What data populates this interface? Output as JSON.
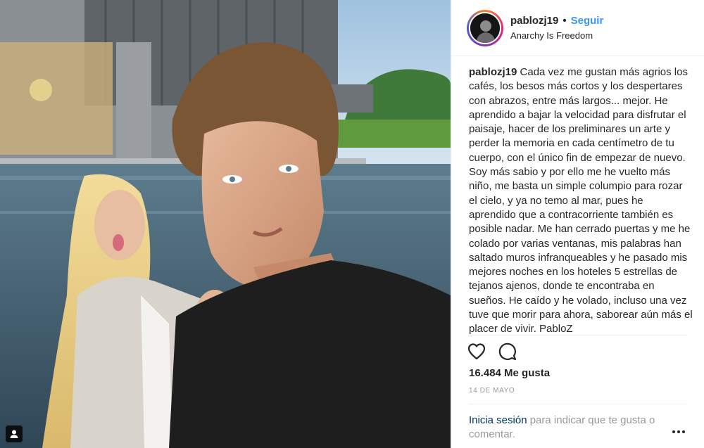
{
  "post": {
    "username": "pablozj19",
    "separator": "•",
    "follow_label": "Seguir",
    "location": "Anarchy Is Freedom",
    "caption_user": "pablozj19",
    "caption_text": "Cada vez me gustan más agrios los cafés, los besos más cortos y los despertares con abrazos, entre más largos... mejor. He aprendido a bajar la velocidad para disfrutar el paisaje, hacer de los preliminares un arte y perder la memoria en cada centímetro de tu cuerpo, con el único fin de empezar de nuevo. Soy más sabio y por ello me he vuelto más niño, me basta un simple columpio para rozar el cielo, y ya no temo al mar, pues he aprendido que a contracorriente también es posible nadar. Me han cerrado puertas y me he colado por varias ventanas, mis palabras han saltado muros infranqueables y he pasado mis mejores noches en los hoteles 5 estrellas de tejanos ajenos, donde te encontraba en sueños. He caído y he volado, incluso una vez tuve que morir para ahora, saborear aún más el placer de vivir. PabloZ",
    "likes": "16.484 Me gusta",
    "date": "14 DE MAYO",
    "login_link": "Inicia sesión",
    "login_rest": " para indicar que te gusta o comentar."
  },
  "icons": {
    "like": "heart-icon",
    "comment": "comment-icon",
    "more": "more-options-icon",
    "tagged": "tagged-user-icon"
  },
  "colors": {
    "follow": "#3897f0",
    "link": "#003569",
    "muted": "#999999",
    "text": "#262626"
  }
}
